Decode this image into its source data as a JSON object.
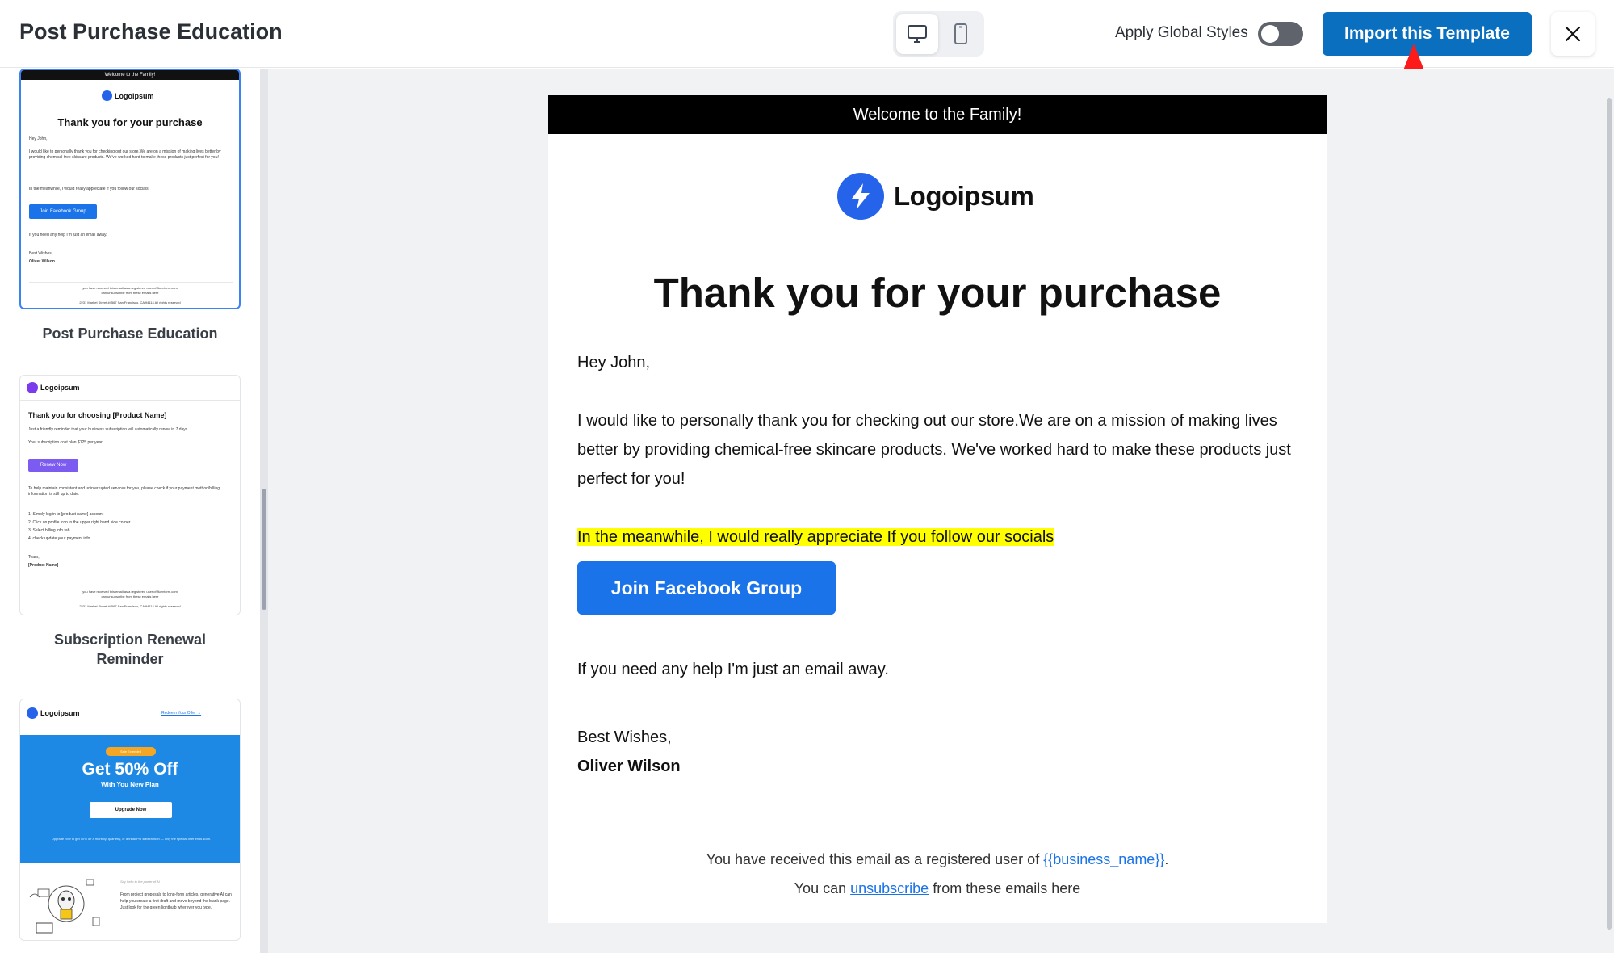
{
  "header": {
    "title": "Post Purchase Education",
    "apply_global_styles_label": "Apply Global Styles",
    "apply_global_styles_on": false,
    "import_label": "Import this Template",
    "device_active": "desktop"
  },
  "colors": {
    "primary": "#0a6fbf",
    "email_button": "#1a73e8",
    "highlight": "#ffff00",
    "arrow": "#ff1a1a"
  },
  "sidebar": {
    "templates": [
      {
        "name": "Post Purchase Education",
        "selected": true,
        "preview": {
          "banner": "Welcome to the Family!",
          "brand": "Logoipsum",
          "heading": "Thank you for your purchase",
          "greeting": "Hey John,",
          "body": "I would like to personally thank you for checking out our store.We are on a mission of making lives better by providing chemical-free skincare products. We've worked hard to make these products just perfect for you!",
          "highlight": "In the meanwhile, I would really appreciate If you follow our socials",
          "button": "Join Facebook Group",
          "help": "If you need any help I'm just an email away.",
          "signoff": "Best Wishes,",
          "signature": "Oliver Wilson",
          "footer1": "you have received this email as a registered user of fluentcrm.com",
          "footer2": "can unsubscribe from these emails here",
          "footer3": "2231 Market Street #4567 San Francisco, CA 94114 All rights reserved"
        }
      },
      {
        "name": "Subscription Renewal Reminder",
        "selected": false,
        "preview": {
          "brand": "Logoipsum",
          "heading": "Thank you for choosing [Product Name]",
          "line1": "Just a friendly reminder that your business subscription will automatically renew in 7 days.",
          "line2": "Your subscription cost plan $125 per year.",
          "button": "Renew Now",
          "para": "To help maintain consistent and uninterrupted services for you, please check if your payment method/billing information is still up to date:",
          "steps": [
            "1. Simply log in to [product name] account",
            "2. Click on profile icon in the upper right hand side corner",
            "3. Select billing info tab",
            "4. check/update your payment info"
          ],
          "team": "Team,",
          "product": "[Product Name]",
          "footer1": "you have received this email as a registered user of fluentcrm.com",
          "footer2": "can unsubscribe from these emails here",
          "footer3": "2231 Market Street #4567 San Francisco, CA 94114 All rights reserved"
        }
      },
      {
        "name": "",
        "selected": false,
        "preview": {
          "brand": "Logoipsum",
          "link": "Redeem Your Offer →",
          "badge": "Sale Extended",
          "heading": "Get 50% Off",
          "subheading": "With You New Plan",
          "button": "Upgrade Now",
          "small": "Upgrade now to get 50% off a monthly, quarterly, or annual Pro subscription — only the special offer ends soon.",
          "caption": "Say hello to the power of AI",
          "para": "From project proposals to long-form articles, generative AI can help you create a first draft and move beyond the blank page. Just look for the green lightbulb wherever you type."
        }
      }
    ]
  },
  "email": {
    "banner": "Welcome to the Family!",
    "brand": "Logoipsum",
    "heading": "Thank you for your purchase",
    "greeting": "Hey John,",
    "body": "I would like to personally thank you for checking out our store.We are on a mission of making lives better by providing chemical-free skincare products. We've worked hard to make these products just perfect for you!",
    "highlight": "In the meanwhile, I would really appreciate If you follow our socials",
    "button": "Join Facebook Group",
    "help": "If you need any help I'm just an email away.",
    "signoff": "Best Wishes,",
    "signature": "Oliver Wilson",
    "footer": {
      "line1_prefix": "You have received this email as a registered user of",
      "business_tag": "{{business_name}}",
      "line1_suffix": ".",
      "line2_prefix": "You can",
      "unsubscribe_label": "unsubscribe",
      "line2_suffix": "from these emails here"
    }
  }
}
